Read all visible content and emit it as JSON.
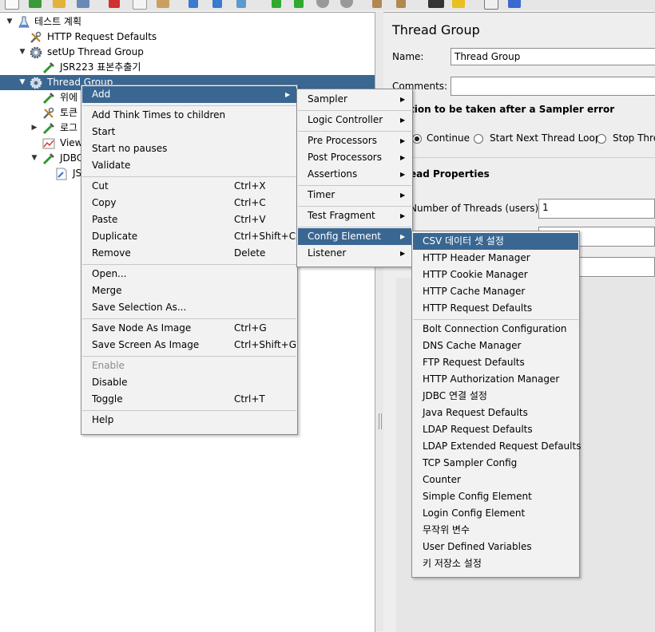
{
  "toolbar": {
    "icons": [
      "new-icon",
      "templates-icon",
      "open-icon",
      "cut-icon",
      "copy-icon",
      "paste-icon",
      "expand-icon",
      "collapse-icon",
      "toggle-icon",
      "start-icon",
      "start-no-pause-icon",
      "stop-icon",
      "shutdown-icon",
      "clear-icon",
      "clear-all-icon",
      "search-icon",
      "reset-search-icon",
      "function-helper-icon",
      "help-icon"
    ]
  },
  "tree": {
    "items": [
      {
        "label": "테스트 계획",
        "icon": "flask-icon"
      },
      {
        "label": "HTTP Request Defaults",
        "icon": "config-wrench-icon"
      },
      {
        "label": "setUp Thread Group",
        "icon": "gear-icon"
      },
      {
        "label": "JSR223 표본추출기",
        "icon": "sampler-pipette-icon"
      },
      {
        "label": "Thread Group",
        "icon": "gear-icon"
      },
      {
        "label": "위에",
        "icon": "sampler-pipette-icon"
      },
      {
        "label": "토큰",
        "icon": "config-wrench-icon"
      },
      {
        "label": "로그",
        "icon": "sampler-pipette-icon"
      },
      {
        "label": "View",
        "icon": "listener-graph-icon"
      },
      {
        "label": "JDBC",
        "icon": "sampler-pipette-icon"
      },
      {
        "label": "JS",
        "icon": "script-icon"
      }
    ]
  },
  "right": {
    "title": "Thread Group",
    "name_label": "Name:",
    "name_value": "Thread Group",
    "comments_label": "Comments:",
    "comments_value": "",
    "error_section": "tion to be taken after a Sampler error",
    "radios": [
      {
        "label": "Continue",
        "checked": true
      },
      {
        "label": "Start Next Thread Loop",
        "checked": false
      },
      {
        "label": "Stop Thre",
        "checked": false
      }
    ],
    "props_section": "ead Properties",
    "threads_label": "Number of Threads (users):",
    "threads_value": "1"
  },
  "context_menu": {
    "items": [
      {
        "label": "Add",
        "shortcut": "",
        "submenu": true,
        "highlight": true
      },
      {
        "label": "Add Think Times to children",
        "shortcut": ""
      },
      {
        "label": "Start",
        "shortcut": ""
      },
      {
        "label": "Start no pauses",
        "shortcut": ""
      },
      {
        "label": "Validate",
        "shortcut": ""
      },
      {
        "label": "Cut",
        "shortcut": "Ctrl+X"
      },
      {
        "label": "Copy",
        "shortcut": "Ctrl+C"
      },
      {
        "label": "Paste",
        "shortcut": "Ctrl+V"
      },
      {
        "label": "Duplicate",
        "shortcut": "Ctrl+Shift+C"
      },
      {
        "label": "Remove",
        "shortcut": "Delete"
      },
      {
        "label": "Open...",
        "shortcut": ""
      },
      {
        "label": "Merge",
        "shortcut": ""
      },
      {
        "label": "Save Selection As...",
        "shortcut": ""
      },
      {
        "label": "Save Node As Image",
        "shortcut": "Ctrl+G"
      },
      {
        "label": "Save Screen As Image",
        "shortcut": "Ctrl+Shift+G"
      },
      {
        "label": "Enable",
        "shortcut": "",
        "disabled": true
      },
      {
        "label": "Disable",
        "shortcut": ""
      },
      {
        "label": "Toggle",
        "shortcut": "Ctrl+T"
      },
      {
        "label": "Help",
        "shortcut": ""
      }
    ]
  },
  "add_menu": {
    "items": [
      {
        "label": "Sampler"
      },
      {
        "label": "Logic Controller"
      },
      {
        "label": "Pre Processors"
      },
      {
        "label": "Post Processors"
      },
      {
        "label": "Assertions"
      },
      {
        "label": "Timer"
      },
      {
        "label": "Test Fragment"
      },
      {
        "label": "Config Element",
        "highlight": true
      },
      {
        "label": "Listener"
      }
    ]
  },
  "config_menu": {
    "items": [
      {
        "label": "CSV 데이터 셋 설정",
        "highlight": true
      },
      {
        "label": "HTTP Header Manager"
      },
      {
        "label": "HTTP Cookie Manager"
      },
      {
        "label": "HTTP Cache Manager"
      },
      {
        "label": "HTTP Request Defaults"
      },
      {
        "label": "Bolt Connection Configuration"
      },
      {
        "label": "DNS Cache Manager"
      },
      {
        "label": "FTP Request Defaults"
      },
      {
        "label": "HTTP Authorization Manager"
      },
      {
        "label": "JDBC 연결 설정"
      },
      {
        "label": "Java Request Defaults"
      },
      {
        "label": "LDAP Request Defaults"
      },
      {
        "label": "LDAP Extended Request Defaults"
      },
      {
        "label": "TCP Sampler Config"
      },
      {
        "label": "Counter"
      },
      {
        "label": "Simple Config Element"
      },
      {
        "label": "Login Config Element"
      },
      {
        "label": "무작위 변수"
      },
      {
        "label": "User Defined Variables"
      },
      {
        "label": "키 저장소 설정"
      }
    ]
  },
  "colors": {
    "selection": "#3a6792",
    "menu_bg": "#f2f2f2",
    "panel_bg": "#eeeeee"
  }
}
